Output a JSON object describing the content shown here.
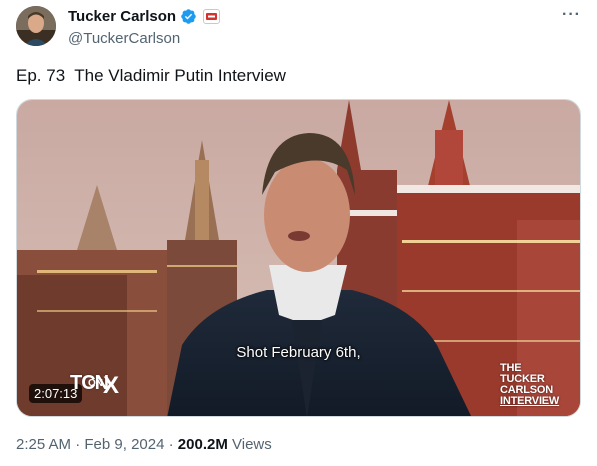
{
  "author": {
    "name": "Tucker Carlson",
    "handle": "@TuckerCarlson",
    "verified_color": "#1d9bf0",
    "avatar_icon": "profile-photo"
  },
  "more_label": "···",
  "tweet": {
    "text": "Ep. 73  The Vladimir Putin Interview"
  },
  "video": {
    "subtitle": "Shot February 6th,",
    "duration": "2:07:13",
    "network_logo": {
      "tcn": "TCN",
      "on": "ON",
      "x": "X"
    },
    "show_logo": {
      "line1": "THE",
      "line2": "TUCKER",
      "line3": "CARLSON",
      "line4": "INTERVIEW"
    }
  },
  "meta": {
    "time": "2:25 AM",
    "sep1": " · ",
    "date": "Feb 9, 2024",
    "sep2": " · ",
    "views_count": "200.2M",
    "views_label": " Views"
  }
}
